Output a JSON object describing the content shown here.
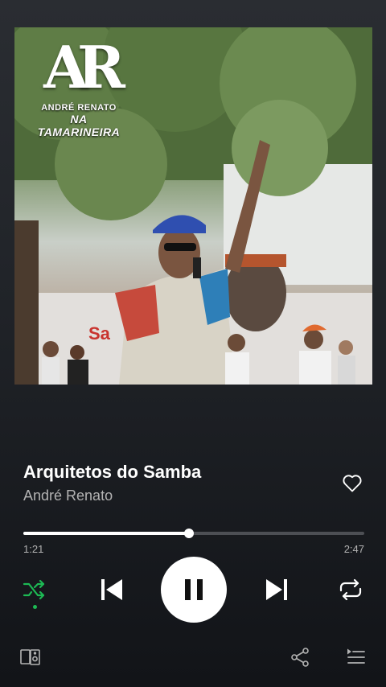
{
  "album_art": {
    "logo_monogram": "AR",
    "logo_line1": "ANDRÉ RENATO",
    "logo_line2": "NA TAMARINEIRA",
    "icon": "album-cover-photo"
  },
  "track": {
    "title": "Arquitetos do Samba",
    "artist": "André Renato",
    "liked": false
  },
  "progress": {
    "current": "1:21",
    "duration": "2:47",
    "fraction": 0.485
  },
  "controls": {
    "shuffle_icon": "shuffle-icon",
    "shuffle_active": true,
    "previous_icon": "skip-previous-icon",
    "play_state": "playing",
    "pause_icon": "pause-icon",
    "next_icon": "skip-next-icon",
    "repeat_icon": "repeat-icon"
  },
  "footer": {
    "devices_icon": "devices-icon",
    "share_icon": "share-icon",
    "queue_icon": "queue-icon"
  },
  "colors": {
    "accent": "#1db954",
    "secondary_text": "#b3b3b3"
  }
}
